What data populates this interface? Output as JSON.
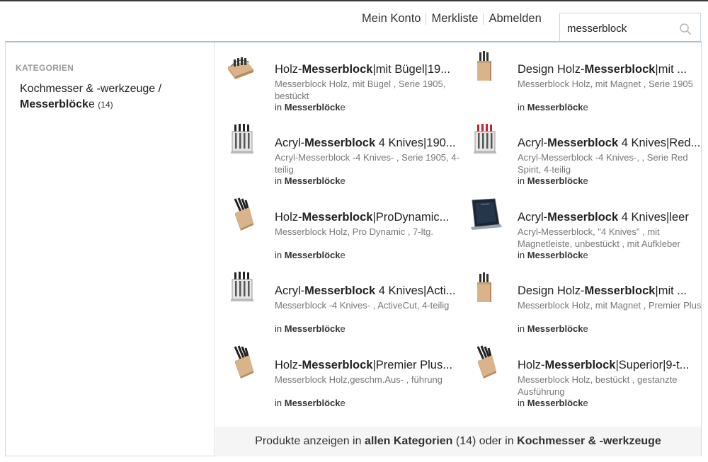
{
  "header": {
    "nav": {
      "account": "Mein Konto",
      "wishlist": "Merkliste",
      "logout": "Abmelden"
    },
    "search": {
      "value": "messerblock",
      "icon": "search-icon"
    }
  },
  "sidebar": {
    "heading": "KATEGORIEN",
    "category": {
      "path": "Kochmesser & -werkzeuge /",
      "name_bold": "Messerblöck",
      "name_rest": "e",
      "count": "(14)"
    }
  },
  "results": [
    {
      "title_pre": "Holz-",
      "title_bold": "Messerblock",
      "title_post": "|mit Bügel|19...",
      "desc": "Messerblock Holz, mit Bügel , Serie 1905, bestückt",
      "cat_pre": "in",
      "cat_bold": "Messerblöck",
      "cat_post": "e",
      "image": "wood-block-rack"
    },
    {
      "title_pre": "Design Holz-",
      "title_bold": "Messerblock",
      "title_post": "|mit ...",
      "desc": "Messerblock Holz, mit Magnet , Serie 1905",
      "cat_pre": "in",
      "cat_bold": "Messerblöck",
      "cat_post": "e",
      "image": "wood-tower-block"
    },
    {
      "title_pre": "Acryl-",
      "title_bold": "Messerblock",
      "title_post": " 4 Knives|190...",
      "desc": "Acryl-Messerblock -4 Knives- , Serie 1905, 4-teilig",
      "cat_pre": "in",
      "cat_bold": "Messerblöck",
      "cat_post": "e",
      "image": "acrylic-block-dark"
    },
    {
      "title_pre": "Acryl-",
      "title_bold": "Messerblock",
      "title_post": " 4 Knives|Red...",
      "desc": "Acryl-Messerblock -4 Knives-, , Serie Red Spirit, 4-teilig",
      "cat_pre": "in",
      "cat_bold": "Messerblöck",
      "cat_post": "e",
      "image": "acrylic-block-red"
    },
    {
      "title_pre": "Holz-",
      "title_bold": "Messerblock",
      "title_post": "|ProDynamic...",
      "desc": "Messerblock Holz, Pro Dynamic , 7-ltg.",
      "cat_pre": "in",
      "cat_bold": "Messerblöck",
      "cat_post": "e",
      "image": "wood-block-angled"
    },
    {
      "title_pre": "Acryl-",
      "title_bold": "Messerblock",
      "title_post": " 4 Knives|leer",
      "desc": "Acryl-Messerblock, \"4 Knives\" , mit Magnetleiste, unbestückt , mit Aufkleber",
      "cat_pre": "in",
      "cat_bold": "Messerblöck",
      "cat_post": "e",
      "image": "acrylic-block-empty"
    },
    {
      "title_pre": "Acryl-",
      "title_bold": "Messerblock",
      "title_post": " 4 Knives|Acti...",
      "desc": "Messerblock -4 Knives- , ActiveCut, 4-teilig",
      "cat_pre": "in",
      "cat_bold": "Messerblöck",
      "cat_post": "e",
      "image": "acrylic-block-dark"
    },
    {
      "title_pre": "Design Holz-",
      "title_bold": "Messerblock",
      "title_post": "|mit ...",
      "desc": "Messerblock Holz, mit Magnet , Premier Plus",
      "cat_pre": "in",
      "cat_bold": "Messerblöck",
      "cat_post": "e",
      "image": "wood-tower-block"
    },
    {
      "title_pre": "Holz-",
      "title_bold": "Messerblock",
      "title_post": "|Premier Plus...",
      "desc": "Messerblock Holz,geschm.Aus- , führung",
      "cat_pre": "in",
      "cat_bold": "Messerblöck",
      "cat_post": "e",
      "image": "wood-block-angled"
    },
    {
      "title_pre": "Holz-",
      "title_bold": "Messerblock",
      "title_post": "|Superior|9-t...",
      "desc": "Messerblock Holz, bestückt , gestanzte Ausführung",
      "cat_pre": "in",
      "cat_bold": "Messerblöck",
      "cat_post": "e",
      "image": "wood-block-angled"
    }
  ],
  "footer": {
    "prefix": "Produkte anzeigen in",
    "all_categories": "allen Kategorien",
    "count": "(14)",
    "middle": "oder in",
    "category": "Kochmesser & -werkzeuge"
  }
}
